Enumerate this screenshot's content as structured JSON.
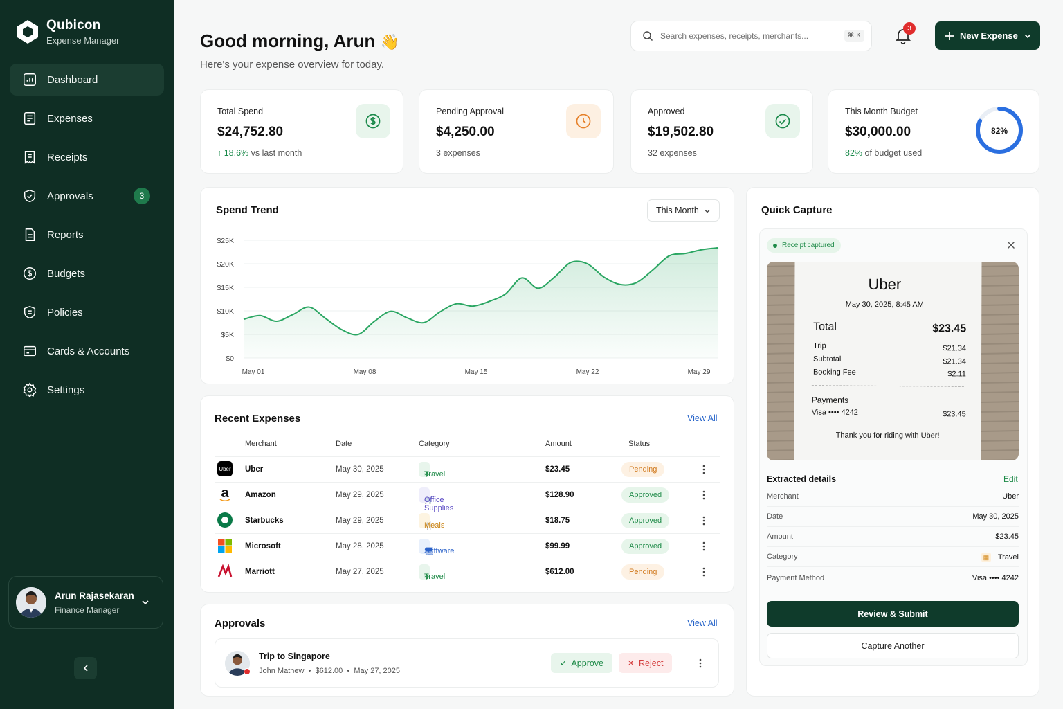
{
  "brand": {
    "name": "Qubicon",
    "subtitle": "Expense Manager"
  },
  "nav": [
    {
      "label": "Dashboard",
      "icon": "dashboard-icon",
      "active": true
    },
    {
      "label": "Expenses",
      "icon": "expenses-icon"
    },
    {
      "label": "Receipts",
      "icon": "receipt-icon"
    },
    {
      "label": "Approvals",
      "icon": "shield-check-icon",
      "badge": "3"
    },
    {
      "label": "Reports",
      "icon": "report-icon"
    },
    {
      "label": "Budgets",
      "icon": "budget-icon"
    },
    {
      "label": "Policies",
      "icon": "policy-icon"
    },
    {
      "label": "Cards & Accounts",
      "icon": "card-icon"
    },
    {
      "label": "Settings",
      "icon": "gear-icon"
    }
  ],
  "user": {
    "name": "Arun Rajasekaran",
    "role": "Finance Manager"
  },
  "header": {
    "greeting": "Good morning, Arun",
    "wave": "👋",
    "subtitle": "Here's your expense overview for today.",
    "search_placeholder": "Search expenses, receipts, merchants...",
    "search_shortcut": "⌘ K",
    "notification_count": "3",
    "new_expense_label": "New Expense"
  },
  "stats": [
    {
      "label": "Total Spend",
      "value": "$24,752.80",
      "change": "18.6%",
      "sub": "vs last month",
      "accent": "#1b8a4b"
    },
    {
      "label": "Pending Approval",
      "value": "$4,250.00",
      "sub": "3 expenses",
      "accent": "#e6812a"
    },
    {
      "label": "Approved",
      "value": "$19,502.80",
      "sub": "32 expenses",
      "accent": "#1b8a4b"
    },
    {
      "label": "This Month Budget",
      "value": "$30,000.00",
      "highlight": "82%",
      "sub": "of budget used",
      "ring": "82%",
      "ring_value": 82,
      "accent": "#2b6fe0"
    }
  ],
  "trend": {
    "title": "Spend Trend",
    "period": "This Month"
  },
  "chart_data": {
    "type": "area",
    "title": "Spend Trend",
    "y_ticks": [
      "$25K",
      "$20K",
      "$15K",
      "$10K",
      "$5K",
      "$0"
    ],
    "x_ticks": [
      "May 01",
      "May 08",
      "May 15",
      "May 22",
      "May 29"
    ],
    "ylim": [
      0,
      25000
    ],
    "x": [
      1,
      2,
      3,
      4,
      5,
      6,
      7,
      8,
      9,
      10,
      11,
      12,
      13,
      14,
      15,
      16,
      17,
      18,
      19,
      20,
      21,
      22,
      23,
      24,
      25,
      26,
      27,
      28,
      29,
      30
    ],
    "values": [
      8200,
      9000,
      7800,
      9200,
      10800,
      8400,
      6000,
      5000,
      7800,
      9900,
      8500,
      7500,
      9800,
      11500,
      11000,
      12000,
      13600,
      17000,
      14800,
      17200,
      20300,
      20000,
      17200,
      15600,
      16000,
      18700,
      21700,
      22200,
      23000,
      23400
    ],
    "grid": true,
    "color": "#2aa662"
  },
  "recent": {
    "title": "Recent Expenses",
    "view_all": "View All",
    "columns": [
      "Merchant",
      "Date",
      "Category",
      "Amount",
      "Status"
    ],
    "rows": [
      {
        "merchant": "Uber",
        "date": "May 30, 2025",
        "category": "Travel",
        "cat_icon": "plane-icon",
        "amount": "$23.45",
        "status": "Pending"
      },
      {
        "merchant": "Amazon",
        "date": "May 29, 2025",
        "category": "Office Supplies",
        "cat_icon": "cart-icon",
        "amount": "$128.90",
        "status": "Approved"
      },
      {
        "merchant": "Starbucks",
        "date": "May 29, 2025",
        "category": "Meals",
        "cat_icon": "utensils-icon",
        "amount": "$18.75",
        "status": "Approved"
      },
      {
        "merchant": "Microsoft",
        "date": "May 28, 2025",
        "category": "Software",
        "cat_icon": "monitor-icon",
        "amount": "$99.99",
        "status": "Approved"
      },
      {
        "merchant": "Marriott",
        "date": "May 27, 2025",
        "category": "Travel",
        "cat_icon": "plane-icon",
        "amount": "$612.00",
        "status": "Pending"
      }
    ]
  },
  "approvals": {
    "title": "Approvals",
    "view_all": "View All",
    "item": {
      "title": "Trip to Singapore",
      "person": "John Mathew",
      "amount": "$612.00",
      "date": "May 27, 2025",
      "approve": "Approve",
      "reject": "Reject"
    }
  },
  "capture": {
    "title": "Quick Capture",
    "badge": "Receipt captured",
    "receipt": {
      "brand": "Uber",
      "datetime": "May 30, 2025, 8:45 AM",
      "total_label": "Total",
      "total": "$23.45",
      "lines": [
        {
          "k": "Trip",
          "v": "$21.34"
        },
        {
          "k": "Subtotal",
          "v": "$21.34"
        },
        {
          "k": "Booking Fee",
          "v": "$2.11"
        }
      ],
      "payments_label": "Payments",
      "card": "Visa •••• 4242",
      "card_amount": "$23.45",
      "thanks": "Thank you for riding with Uber!"
    },
    "details_title": "Extracted details",
    "edit": "Edit",
    "details": [
      {
        "k": "Merchant",
        "v": "Uber"
      },
      {
        "k": "Date",
        "v": "May 30, 2025"
      },
      {
        "k": "Amount",
        "v": "$23.45"
      },
      {
        "k": "Category",
        "v": "Travel"
      },
      {
        "k": "Payment Method",
        "v": "Visa •••• 4242"
      }
    ],
    "submit": "Review & Submit",
    "another": "Capture Another"
  }
}
